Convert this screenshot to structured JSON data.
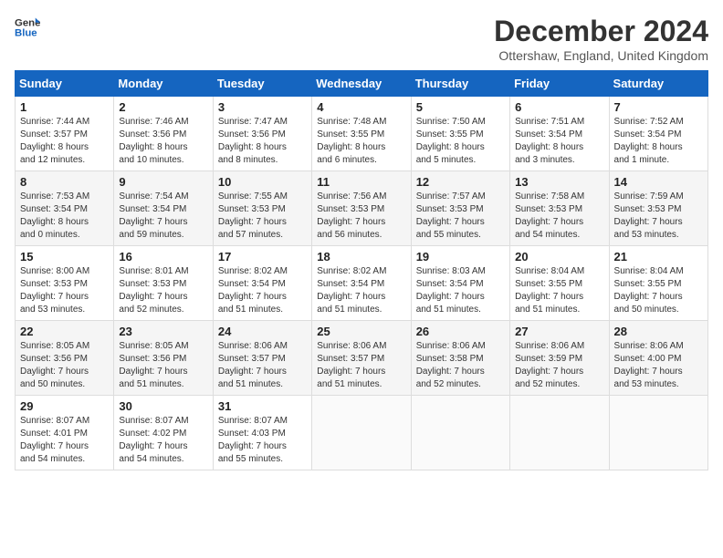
{
  "header": {
    "logo_line1": "General",
    "logo_line2": "Blue",
    "month_title": "December 2024",
    "location": "Ottershaw, England, United Kingdom"
  },
  "weekdays": [
    "Sunday",
    "Monday",
    "Tuesday",
    "Wednesday",
    "Thursday",
    "Friday",
    "Saturday"
  ],
  "weeks": [
    [
      {
        "day": "1",
        "info": "Sunrise: 7:44 AM\nSunset: 3:57 PM\nDaylight: 8 hours\nand 12 minutes."
      },
      {
        "day": "2",
        "info": "Sunrise: 7:46 AM\nSunset: 3:56 PM\nDaylight: 8 hours\nand 10 minutes."
      },
      {
        "day": "3",
        "info": "Sunrise: 7:47 AM\nSunset: 3:56 PM\nDaylight: 8 hours\nand 8 minutes."
      },
      {
        "day": "4",
        "info": "Sunrise: 7:48 AM\nSunset: 3:55 PM\nDaylight: 8 hours\nand 6 minutes."
      },
      {
        "day": "5",
        "info": "Sunrise: 7:50 AM\nSunset: 3:55 PM\nDaylight: 8 hours\nand 5 minutes."
      },
      {
        "day": "6",
        "info": "Sunrise: 7:51 AM\nSunset: 3:54 PM\nDaylight: 8 hours\nand 3 minutes."
      },
      {
        "day": "7",
        "info": "Sunrise: 7:52 AM\nSunset: 3:54 PM\nDaylight: 8 hours\nand 1 minute."
      }
    ],
    [
      {
        "day": "8",
        "info": "Sunrise: 7:53 AM\nSunset: 3:54 PM\nDaylight: 8 hours\nand 0 minutes."
      },
      {
        "day": "9",
        "info": "Sunrise: 7:54 AM\nSunset: 3:54 PM\nDaylight: 7 hours\nand 59 minutes."
      },
      {
        "day": "10",
        "info": "Sunrise: 7:55 AM\nSunset: 3:53 PM\nDaylight: 7 hours\nand 57 minutes."
      },
      {
        "day": "11",
        "info": "Sunrise: 7:56 AM\nSunset: 3:53 PM\nDaylight: 7 hours\nand 56 minutes."
      },
      {
        "day": "12",
        "info": "Sunrise: 7:57 AM\nSunset: 3:53 PM\nDaylight: 7 hours\nand 55 minutes."
      },
      {
        "day": "13",
        "info": "Sunrise: 7:58 AM\nSunset: 3:53 PM\nDaylight: 7 hours\nand 54 minutes."
      },
      {
        "day": "14",
        "info": "Sunrise: 7:59 AM\nSunset: 3:53 PM\nDaylight: 7 hours\nand 53 minutes."
      }
    ],
    [
      {
        "day": "15",
        "info": "Sunrise: 8:00 AM\nSunset: 3:53 PM\nDaylight: 7 hours\nand 53 minutes."
      },
      {
        "day": "16",
        "info": "Sunrise: 8:01 AM\nSunset: 3:53 PM\nDaylight: 7 hours\nand 52 minutes."
      },
      {
        "day": "17",
        "info": "Sunrise: 8:02 AM\nSunset: 3:54 PM\nDaylight: 7 hours\nand 51 minutes."
      },
      {
        "day": "18",
        "info": "Sunrise: 8:02 AM\nSunset: 3:54 PM\nDaylight: 7 hours\nand 51 minutes."
      },
      {
        "day": "19",
        "info": "Sunrise: 8:03 AM\nSunset: 3:54 PM\nDaylight: 7 hours\nand 51 minutes."
      },
      {
        "day": "20",
        "info": "Sunrise: 8:04 AM\nSunset: 3:55 PM\nDaylight: 7 hours\nand 51 minutes."
      },
      {
        "day": "21",
        "info": "Sunrise: 8:04 AM\nSunset: 3:55 PM\nDaylight: 7 hours\nand 50 minutes."
      }
    ],
    [
      {
        "day": "22",
        "info": "Sunrise: 8:05 AM\nSunset: 3:56 PM\nDaylight: 7 hours\nand 50 minutes."
      },
      {
        "day": "23",
        "info": "Sunrise: 8:05 AM\nSunset: 3:56 PM\nDaylight: 7 hours\nand 51 minutes."
      },
      {
        "day": "24",
        "info": "Sunrise: 8:06 AM\nSunset: 3:57 PM\nDaylight: 7 hours\nand 51 minutes."
      },
      {
        "day": "25",
        "info": "Sunrise: 8:06 AM\nSunset: 3:57 PM\nDaylight: 7 hours\nand 51 minutes."
      },
      {
        "day": "26",
        "info": "Sunrise: 8:06 AM\nSunset: 3:58 PM\nDaylight: 7 hours\nand 52 minutes."
      },
      {
        "day": "27",
        "info": "Sunrise: 8:06 AM\nSunset: 3:59 PM\nDaylight: 7 hours\nand 52 minutes."
      },
      {
        "day": "28",
        "info": "Sunrise: 8:06 AM\nSunset: 4:00 PM\nDaylight: 7 hours\nand 53 minutes."
      }
    ],
    [
      {
        "day": "29",
        "info": "Sunrise: 8:07 AM\nSunset: 4:01 PM\nDaylight: 7 hours\nand 54 minutes."
      },
      {
        "day": "30",
        "info": "Sunrise: 8:07 AM\nSunset: 4:02 PM\nDaylight: 7 hours\nand 54 minutes."
      },
      {
        "day": "31",
        "info": "Sunrise: 8:07 AM\nSunset: 4:03 PM\nDaylight: 7 hours\nand 55 minutes."
      },
      null,
      null,
      null,
      null
    ]
  ]
}
